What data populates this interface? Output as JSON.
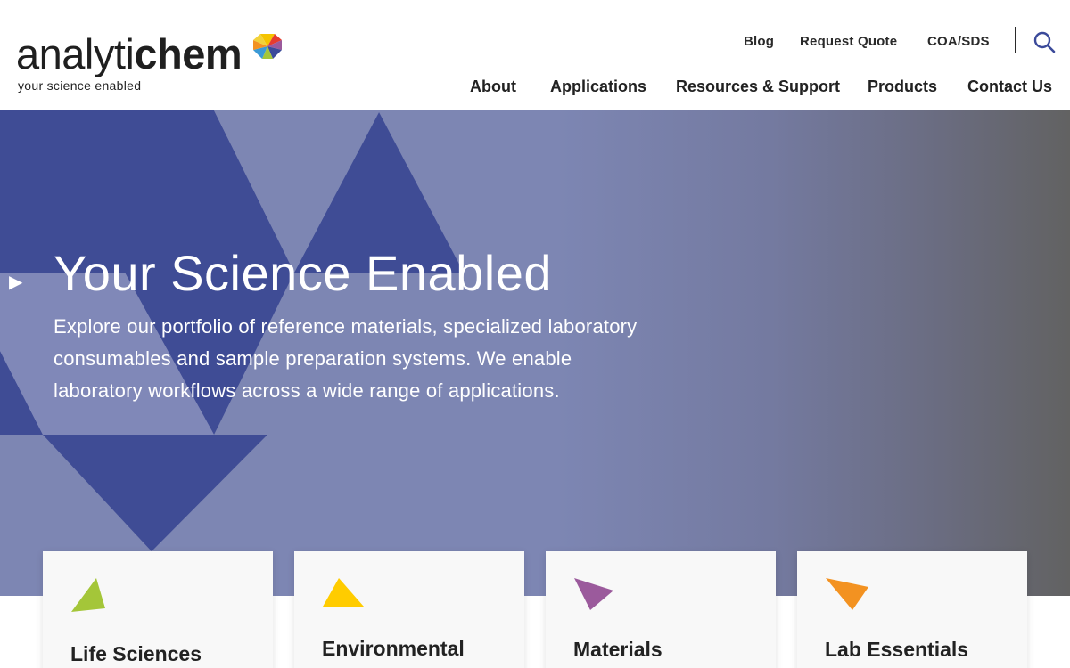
{
  "logo": {
    "word_light": "analyti",
    "word_bold": "chem",
    "tagline": "your science enabled"
  },
  "utility_nav": [
    {
      "label": "Blog"
    },
    {
      "label": "Request Quote"
    },
    {
      "label": "COA/SDS"
    }
  ],
  "main_nav": [
    {
      "label": "About"
    },
    {
      "label": "Applications"
    },
    {
      "label": "Resources & Support"
    },
    {
      "label": "Products"
    },
    {
      "label": "Contact Us"
    }
  ],
  "hero": {
    "title": "Your Science Enabled",
    "text": "Explore our portfolio of reference materials, specialized laboratory consumables and sample preparation systems. We enable laboratory workflows across a wide range of applications."
  },
  "categories": [
    {
      "label": "Life Sciences",
      "icon": "green-triangle-icon",
      "color": "#a4c639"
    },
    {
      "label": "Environmental",
      "icon": "yellow-triangle-icon",
      "color": "#ffcc00"
    },
    {
      "label": "Materials",
      "icon": "purple-triangle-icon",
      "color": "#9b5a9c"
    },
    {
      "label": "Lab Essentials",
      "icon": "orange-triangle-icon",
      "color": "#f39221"
    }
  ],
  "colors": {
    "hero_blue": "#7d86b3",
    "shape_navy": "#3f4c95",
    "hero_gray": "#626262",
    "logo_blue": "#3b4a9a"
  }
}
